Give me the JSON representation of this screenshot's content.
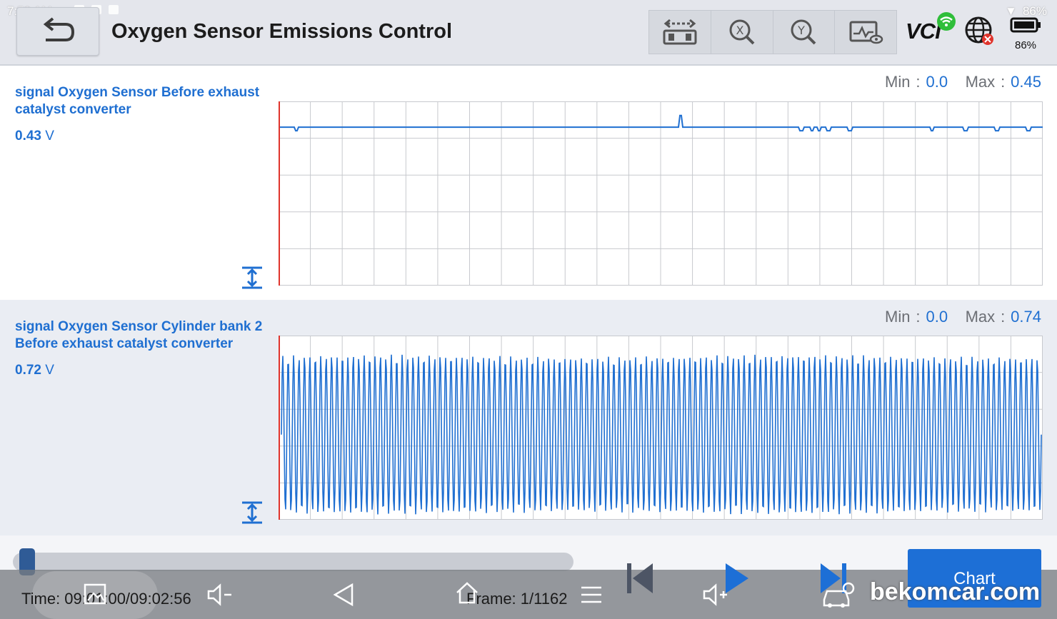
{
  "status_bar": {
    "time": "7:59 AM",
    "battery_text": "86%"
  },
  "header": {
    "title": "Oxygen Sensor Emissions Control",
    "toolbar_icons": [
      "compare-icon",
      "zoom-x-icon",
      "zoom-y-icon",
      "display-mode-icon"
    ],
    "vci_label": "VCI",
    "battery_pct": "86%"
  },
  "signals": [
    {
      "name": "signal Oxygen Sensor Before exhaust catalyst converter",
      "value": "0.43",
      "unit": "V",
      "min_label": "Min",
      "min_value": "0.0",
      "max_label": "Max",
      "max_value": "0.45"
    },
    {
      "name": "signal Oxygen Sensor Cylinder bank 2 Before exhaust catalyst converter",
      "value": "0.72",
      "unit": "V",
      "min_label": "Min",
      "min_value": "0.0",
      "max_label": "Max",
      "max_value": "0.74"
    }
  ],
  "chart_data": [
    {
      "type": "line",
      "series": [
        {
          "baseline": 0.43,
          "spike_max": 0.45,
          "behavior": "flat with small dips"
        }
      ],
      "ylim": [
        0,
        0.5
      ],
      "grid": true,
      "columns": 24,
      "rows": 5
    },
    {
      "type": "line",
      "series": [
        {
          "low": 0.02,
          "high": 0.72,
          "cycles": 140,
          "behavior": "rapid oscillation"
        }
      ],
      "ylim": [
        0,
        0.8
      ],
      "grid": true,
      "columns": 24,
      "rows": 5
    }
  ],
  "playback": {
    "progress": 0.01,
    "time_label": "Time: 09:01:00/09:02:56",
    "frame_label": "Frame: 1/1162",
    "chart_button": "Chart"
  },
  "watermark": "bekomcar.com",
  "colors": {
    "accent": "#1f6fd1",
    "cursor": "#e0342c",
    "grid": "#c7c9ce"
  }
}
